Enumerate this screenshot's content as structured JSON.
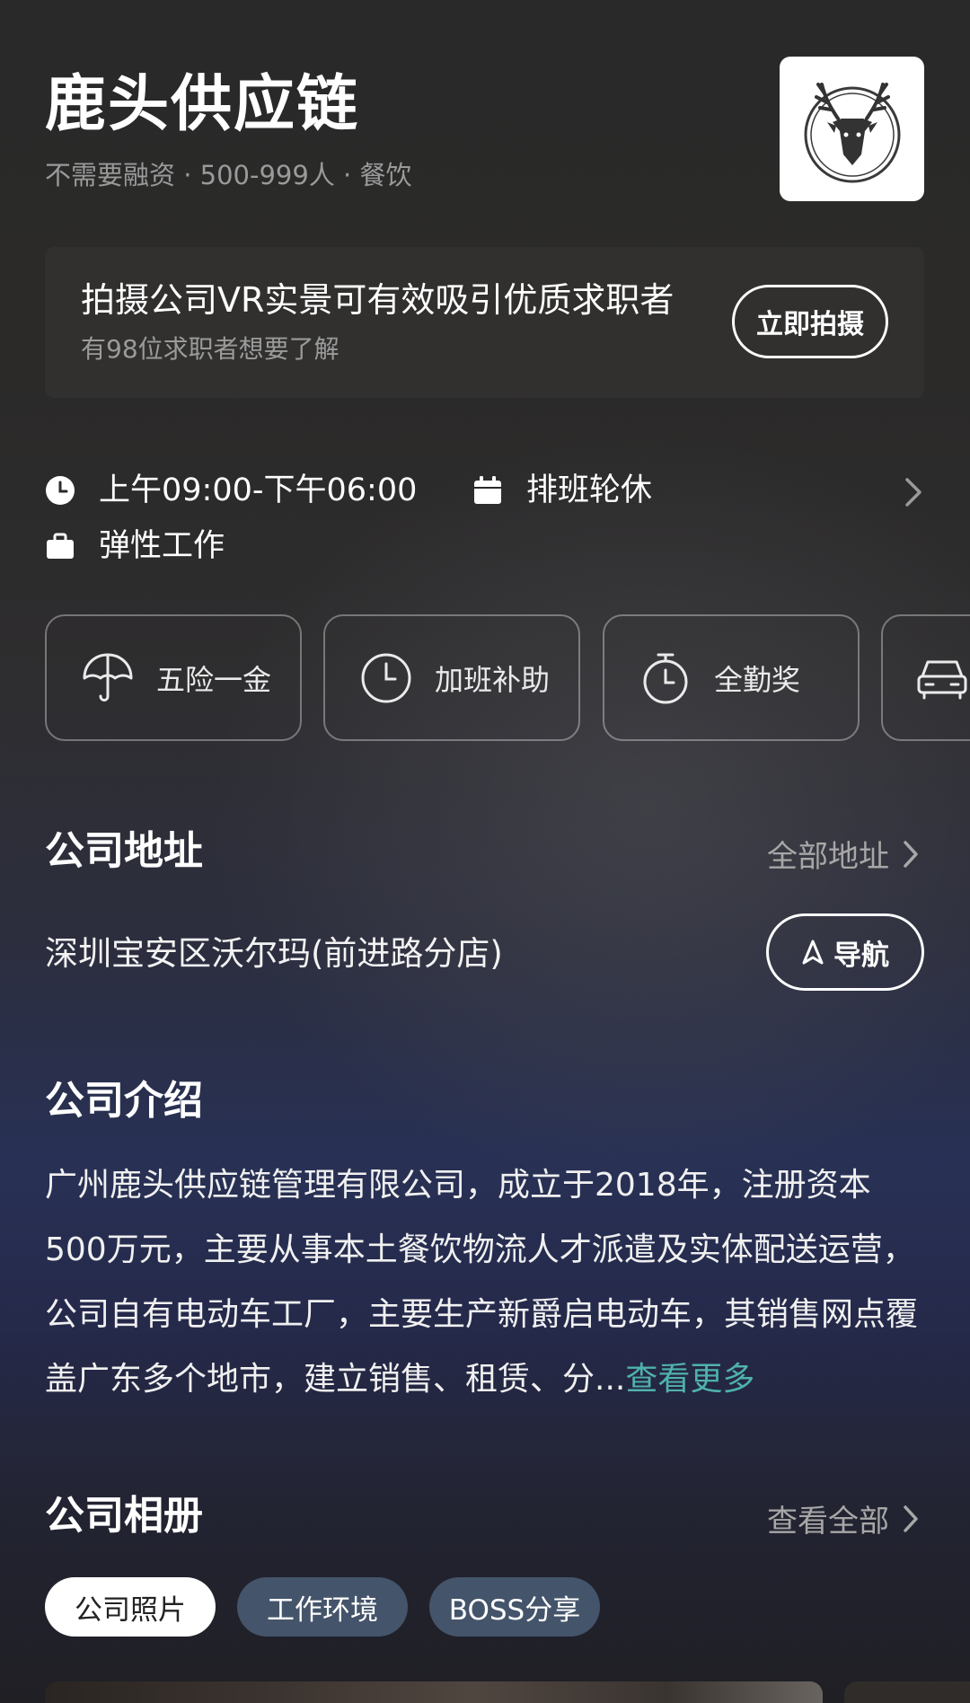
{
  "header": {
    "company_name": "鹿头供应链",
    "meta": "不需要融资 · 500-999人 · 餐饮",
    "logo_icon": "deer-head-icon"
  },
  "vr_banner": {
    "title": "拍摄公司VR实景可有效吸引优质求职者",
    "subtitle": "有98位求职者想要了解",
    "button_label": "立即拍摄"
  },
  "work_info": {
    "hours": "上午09:00-下午06:00",
    "schedule": "排班轮休",
    "mode": "弹性工作"
  },
  "benefits": [
    {
      "label": "五险一金",
      "icon": "umbrella-icon"
    },
    {
      "label": "加班补助",
      "icon": "clock-icon"
    },
    {
      "label": "全勤奖",
      "icon": "stopwatch-icon"
    },
    {
      "label": "",
      "icon": "car-icon"
    }
  ],
  "address": {
    "title": "公司地址",
    "link_label": "全部地址",
    "text": "深圳宝安区沃尔玛(前进路分店)",
    "nav_button_label": "导航"
  },
  "intro": {
    "title": "公司介绍",
    "text": "广州鹿头供应链管理有限公司，成立于2018年，注册资本500万元，主要从事本土餐饮物流人才派遣及实体配送运营， 公司自有电动车工厂，主要生产新爵启电动车，其销售网点覆盖广东多个地市，建立销售、租赁、分...",
    "more_label": "查看更多"
  },
  "album": {
    "title": "公司相册",
    "link_label": "查看全部",
    "tabs": [
      {
        "label": "公司照片",
        "active": true
      },
      {
        "label": "工作环境",
        "active": false
      },
      {
        "label": "BOSS分享",
        "active": false
      }
    ]
  },
  "colors": {
    "accent_link": "#4fb2ab",
    "inactive_tab": "#44546a",
    "muted_text": "#9a9a9a"
  }
}
